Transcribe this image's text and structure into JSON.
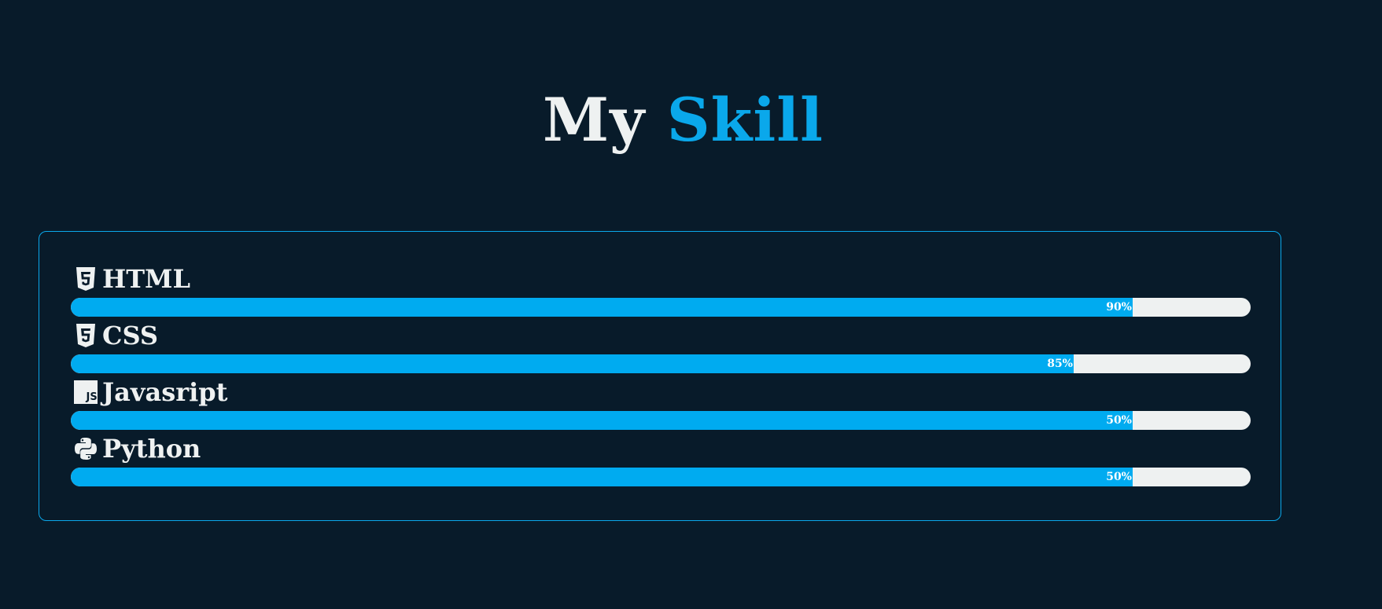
{
  "heading": {
    "word1": "My",
    "word2": "Skill"
  },
  "colors": {
    "background": "#081b2a",
    "accent": "#0aa8eb",
    "bar_fill": "#00abf0",
    "bar_track": "#eef1f1",
    "text": "#eef1f1"
  },
  "skills": [
    {
      "name": "HTML",
      "icon": "html5-icon",
      "percent_label": "90%",
      "fill_fraction": 0.9
    },
    {
      "name": "CSS",
      "icon": "css3-icon",
      "percent_label": "85%",
      "fill_fraction": 0.85
    },
    {
      "name": "Javasript",
      "icon": "javascript-icon",
      "percent_label": "50%",
      "fill_fraction": 0.9
    },
    {
      "name": "Python",
      "icon": "python-icon",
      "percent_label": "50%",
      "fill_fraction": 0.9
    }
  ]
}
